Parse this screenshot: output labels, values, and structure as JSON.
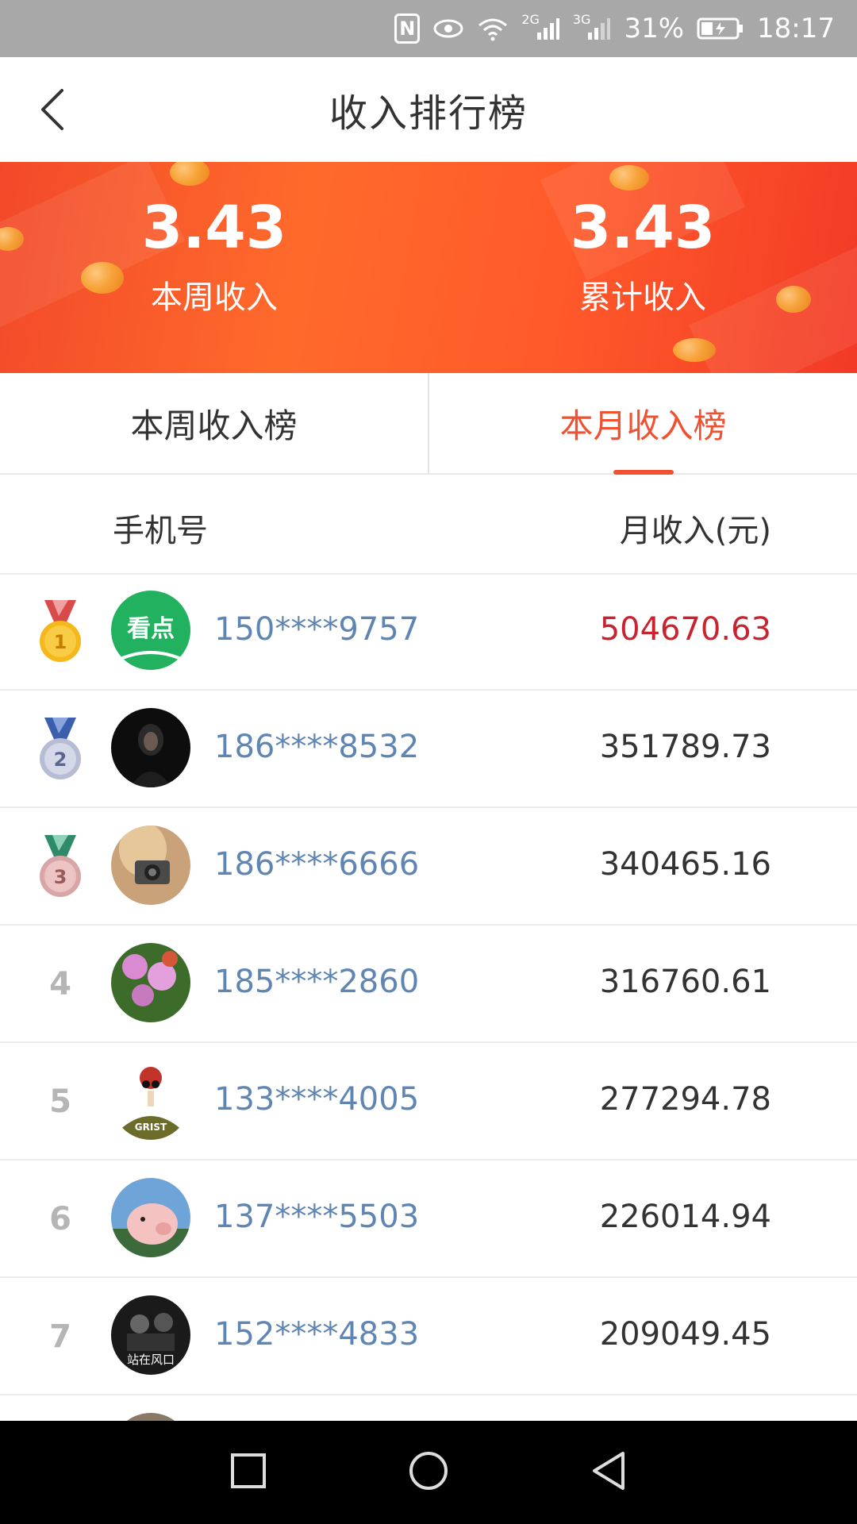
{
  "status_bar": {
    "net_2g": "2G",
    "net_3g": "3G",
    "battery": "31%",
    "time": "18:17"
  },
  "header": {
    "title": "收入排行榜"
  },
  "summary": {
    "weekly": {
      "value": "3.43",
      "label": "本周收入"
    },
    "total": {
      "value": "3.43",
      "label": "累计收入"
    }
  },
  "tabs": [
    {
      "label": "本周收入榜",
      "active": false
    },
    {
      "label": "本月收入榜",
      "active": true
    }
  ],
  "columns": {
    "phone": "手机号",
    "income": "月收入(元)"
  },
  "rows": [
    {
      "rank": "1",
      "phone": "150****9757",
      "amount": "504670.63"
    },
    {
      "rank": "2",
      "phone": "186****8532",
      "amount": "351789.73"
    },
    {
      "rank": "3",
      "phone": "186****6666",
      "amount": "340465.16"
    },
    {
      "rank": "4",
      "phone": "185****2860",
      "amount": "316760.61"
    },
    {
      "rank": "5",
      "phone": "133****4005",
      "amount": "277294.78"
    },
    {
      "rank": "6",
      "phone": "137****5503",
      "amount": "226014.94"
    },
    {
      "rank": "7",
      "phone": "152****4833",
      "amount": "209049.45"
    }
  ],
  "avatars": [
    {
      "text": "看点"
    },
    {
      "text": ""
    },
    {
      "text": ""
    },
    {
      "text": ""
    },
    {
      "text": "GRIST"
    },
    {
      "text": ""
    },
    {
      "text": "站在风口"
    }
  ],
  "colors": {
    "accent": "#ee5232",
    "top_amount": "#c8232e",
    "phone": "#5f86b3"
  },
  "icons": {
    "back": "chevron-left-icon",
    "nav_recent": "square-icon",
    "nav_home": "circle-icon",
    "nav_back": "triangle-back-icon"
  }
}
